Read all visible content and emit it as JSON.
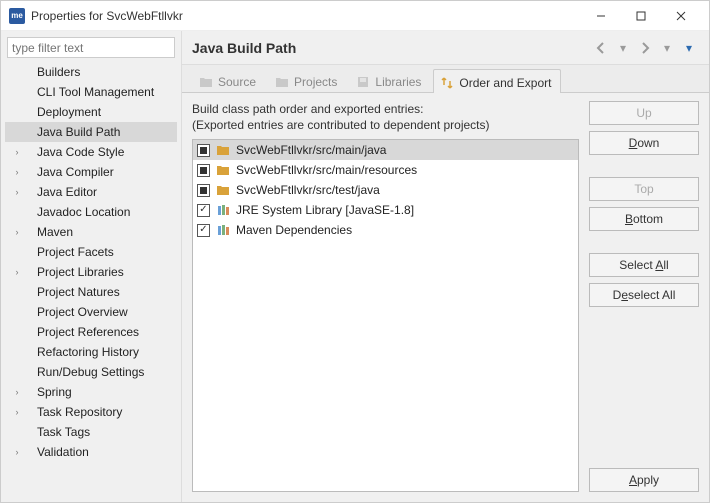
{
  "window": {
    "title": "Properties for SvcWebFtllvkr"
  },
  "filter": {
    "placeholder": "type filter text"
  },
  "tree": {
    "items": [
      {
        "label": "Builders",
        "arrow": ""
      },
      {
        "label": "CLI Tool Management",
        "arrow": ""
      },
      {
        "label": "Deployment",
        "arrow": ""
      },
      {
        "label": "Java Build Path",
        "arrow": "",
        "selected": true
      },
      {
        "label": "Java Code Style",
        "arrow": "›"
      },
      {
        "label": "Java Compiler",
        "arrow": "›"
      },
      {
        "label": "Java Editor",
        "arrow": "›"
      },
      {
        "label": "Javadoc Location",
        "arrow": ""
      },
      {
        "label": "Maven",
        "arrow": "›"
      },
      {
        "label": "Project Facets",
        "arrow": ""
      },
      {
        "label": "Project Libraries",
        "arrow": "›"
      },
      {
        "label": "Project Natures",
        "arrow": ""
      },
      {
        "label": "Project Overview",
        "arrow": ""
      },
      {
        "label": "Project References",
        "arrow": ""
      },
      {
        "label": "Refactoring History",
        "arrow": ""
      },
      {
        "label": "Run/Debug Settings",
        "arrow": ""
      },
      {
        "label": "Spring",
        "arrow": "›"
      },
      {
        "label": "Task Repository",
        "arrow": "›"
      },
      {
        "label": "Task Tags",
        "arrow": ""
      },
      {
        "label": "Validation",
        "arrow": "›"
      }
    ]
  },
  "header": {
    "title": "Java Build Path"
  },
  "tabs": [
    {
      "label": "Source",
      "icon": "folder",
      "active": false
    },
    {
      "label": "Projects",
      "icon": "folder",
      "active": false
    },
    {
      "label": "Libraries",
      "icon": "book",
      "active": false
    },
    {
      "label": "Order and Export",
      "icon": "order",
      "active": true
    }
  ],
  "desc": {
    "line1": "Build class path order and exported entries:",
    "line2": "(Exported entries are contributed to dependent projects)"
  },
  "entries": [
    {
      "label": "SvcWebFtllvkr/src/main/java",
      "check": "square",
      "icon": "pkg",
      "selected": true
    },
    {
      "label": "SvcWebFtllvkr/src/main/resources",
      "check": "square",
      "icon": "pkg",
      "selected": false
    },
    {
      "label": "SvcWebFtllvkr/src/test/java",
      "check": "square",
      "icon": "pkg",
      "selected": false
    },
    {
      "label": "JRE System Library [JavaSE-1.8]",
      "check": "tick",
      "icon": "lib",
      "selected": false
    },
    {
      "label": "Maven Dependencies",
      "check": "tick",
      "icon": "lib",
      "selected": false
    }
  ],
  "buttons": {
    "up": "Up",
    "down": "Down",
    "top": "Top",
    "bottom": "Bottom",
    "select_all": "Select All",
    "deselect_all": "Deselect All",
    "apply": "Apply"
  }
}
